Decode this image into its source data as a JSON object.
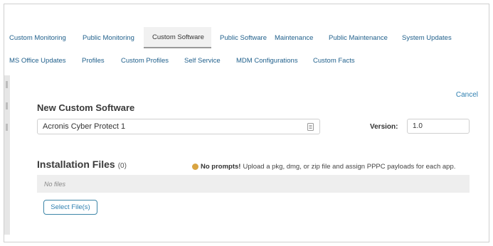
{
  "tabs_row1": [
    {
      "label": "Custom Monitoring",
      "active": false
    },
    {
      "label": "Public Monitoring",
      "active": false
    },
    {
      "label": "Custom Software",
      "active": true
    },
    {
      "label": "Public Software",
      "active": false
    },
    {
      "label": "Maintenance",
      "active": false
    },
    {
      "label": "Public Maintenance",
      "active": false
    },
    {
      "label": "System Updates",
      "active": false
    }
  ],
  "tabs_row2": [
    {
      "label": "MS Office Updates"
    },
    {
      "label": "Profiles"
    },
    {
      "label": "Custom Profiles"
    },
    {
      "label": "Self Service"
    },
    {
      "label": "MDM Configurations"
    },
    {
      "label": "Custom Facts"
    }
  ],
  "form": {
    "cancel_label": "Cancel",
    "title": "New Custom Software",
    "name_value": "Acronis Cyber Protect 1",
    "name_field_icon": "clipboard-icon",
    "version_label": "Version:",
    "version_value": "1.0"
  },
  "installation": {
    "heading": "Installation Files",
    "count": "(0)",
    "notice_emoji": "hand-icon",
    "notice_bold": "No prompts!",
    "notice_text": " Upload a pkg, dmg, or zip file and assign PPPC payloads for each app.",
    "empty_text": "No files",
    "select_button_label": "Select File(s)"
  },
  "colors": {
    "link": "#2e7fb0",
    "active_tab_bg": "#f1f1f1",
    "table_bg": "#eeeeee"
  }
}
